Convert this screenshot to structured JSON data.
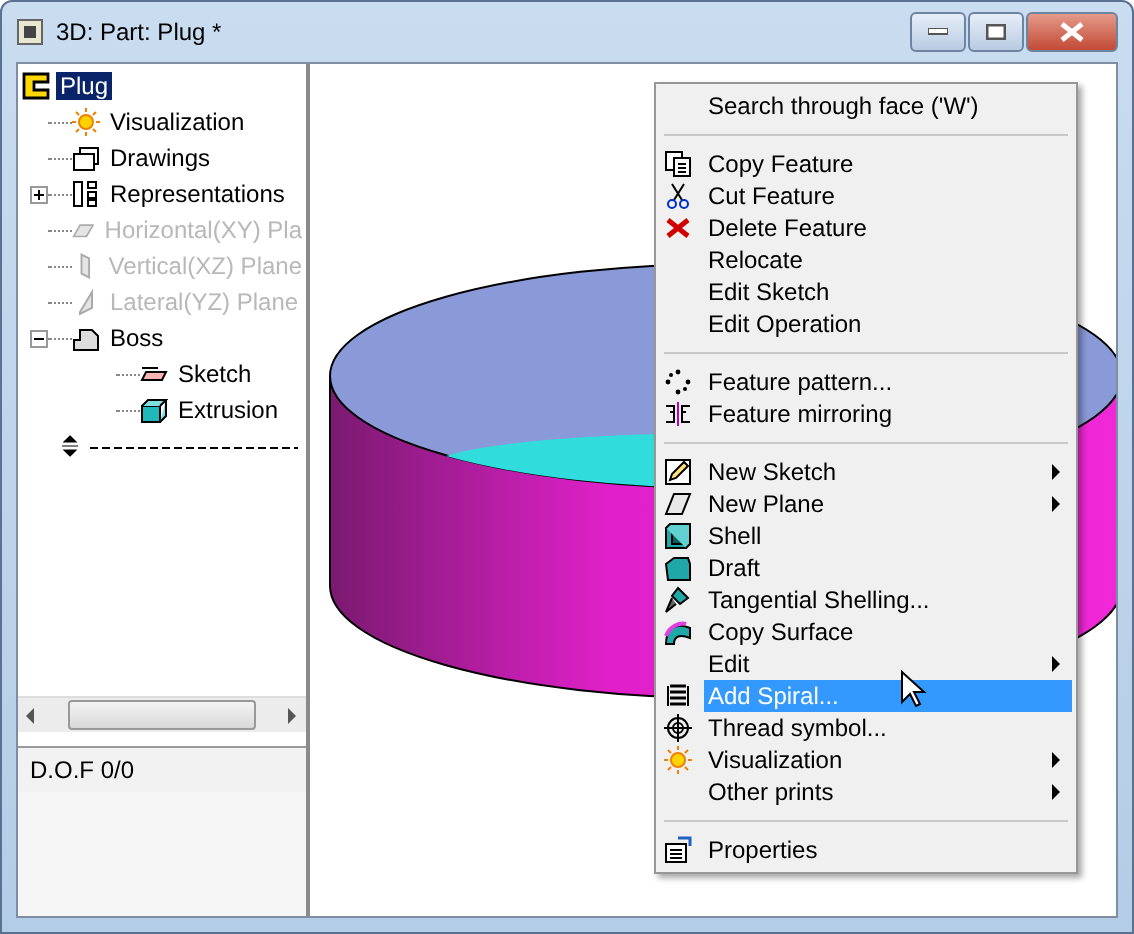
{
  "window": {
    "title": "3D: Part: Plug *"
  },
  "tree": [
    {
      "label": "Plug",
      "selected": true,
      "children": [
        {
          "label": "Visualization",
          "selected": false,
          "disabled": false
        },
        {
          "label": "Drawings",
          "selected": false,
          "disabled": false
        },
        {
          "label": "Representations",
          "selected": false,
          "disabled": false,
          "expanded": false
        },
        {
          "label": "Horizontal(XY) Pla",
          "selected": false,
          "disabled": true
        },
        {
          "label": "Vertical(XZ) Plane",
          "selected": false,
          "disabled": true
        },
        {
          "label": "Lateral(YZ) Plane",
          "selected": false,
          "disabled": true
        },
        {
          "label": "Boss",
          "selected": false,
          "disabled": false,
          "expanded": true,
          "children": [
            {
              "label": "Sketch",
              "selected": false,
              "disabled": false
            },
            {
              "label": "Extrusion",
              "selected": false,
              "disabled": false
            }
          ]
        }
      ]
    }
  ],
  "status": "D.O.F 0/0",
  "menu": [
    [
      {
        "label": "Search through face ('W')",
        "submenu": false,
        "selected": false
      }
    ],
    [
      {
        "label": "Copy Feature",
        "submenu": false,
        "selected": false
      },
      {
        "label": "Cut Feature",
        "submenu": false,
        "selected": false
      },
      {
        "label": "Delete Feature",
        "submenu": false,
        "selected": false
      },
      {
        "label": "Relocate",
        "submenu": false,
        "selected": false
      },
      {
        "label": "Edit Sketch",
        "submenu": false,
        "selected": false
      },
      {
        "label": "Edit Operation",
        "submenu": false,
        "selected": false
      }
    ],
    [
      {
        "label": "Feature pattern...",
        "submenu": false,
        "selected": false
      },
      {
        "label": "Feature mirroring",
        "submenu": false,
        "selected": false
      }
    ],
    [
      {
        "label": "New Sketch",
        "submenu": true,
        "selected": false
      },
      {
        "label": "New Plane",
        "submenu": true,
        "selected": false
      },
      {
        "label": "Shell",
        "submenu": false,
        "selected": false
      },
      {
        "label": "Draft",
        "submenu": false,
        "selected": false
      },
      {
        "label": "Tangential Shelling...",
        "submenu": false,
        "selected": false
      },
      {
        "label": "Copy Surface",
        "submenu": false,
        "selected": false
      },
      {
        "label": "Edit",
        "submenu": true,
        "selected": false
      },
      {
        "label": "Add Spiral...",
        "submenu": false,
        "selected": true
      },
      {
        "label": "Thread symbol...",
        "submenu": false,
        "selected": false
      },
      {
        "label": "Visualization",
        "submenu": true,
        "selected": false
      },
      {
        "label": "Other prints",
        "submenu": true,
        "selected": false
      }
    ],
    [
      {
        "label": "Properties",
        "submenu": false,
        "selected": false
      }
    ]
  ]
}
